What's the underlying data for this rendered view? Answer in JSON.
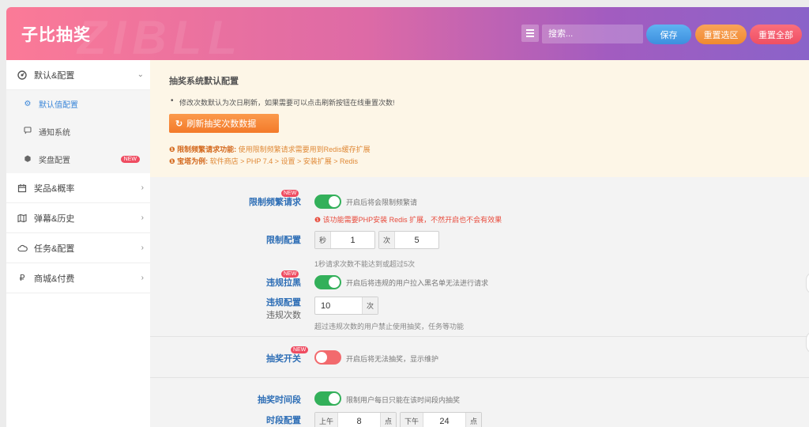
{
  "header": {
    "brand": "子比抽奖",
    "watermark": "ZIBLL",
    "search_placeholder": "搜索...",
    "save_label": "保存",
    "reset_section_label": "重置选区",
    "reset_all_label": "重置全部"
  },
  "sidebar": {
    "items": [
      {
        "icon": "dashboard-icon",
        "label": "默认&配置",
        "expanded": true
      },
      {
        "icon": "cube-icon",
        "label": "奖品&概率"
      },
      {
        "icon": "map-icon",
        "label": "弹幕&历史"
      },
      {
        "icon": "cloud-icon",
        "label": "任务&配置"
      },
      {
        "icon": "ruble-icon",
        "label": "商城&付费"
      }
    ],
    "subitems": [
      {
        "label": "默认值配置",
        "active": true
      },
      {
        "label": "通知系统"
      },
      {
        "label": "奖盘配置",
        "badge": "NEW"
      }
    ]
  },
  "notice": {
    "title": "抽奖系统默认配置",
    "item": "修改次数默认为次日刷新，如果需要可以点击刷新按钮在线重置次数!",
    "refresh_button": "刷新抽奖次数数据",
    "tip1_label": "限制频繁请求功能:",
    "tip1_text": "使用限制频繁请求需要用到Redis缓存扩展",
    "tip2_label": "宝塔为例:",
    "tip2_text": "软件商店 > PHP 7.4 > 设置 > 安装扩展 > Redis"
  },
  "settings": {
    "limit_freq": {
      "label": "限制频繁请求",
      "badge": "NEW",
      "enabled": true,
      "desc": "开启后将会限制频繁请",
      "warning": "该功能需要PHP安装 Redis 扩展，不然开启也不会有效果"
    },
    "limit_config": {
      "label": "限制配置",
      "sec_unit": "秒",
      "sec_value": "1",
      "count_unit": "次",
      "count_value": "5",
      "hint": "1秒请求次数不能达到或超过5次"
    },
    "blacklist": {
      "label": "违规拉黑",
      "badge": "NEW",
      "enabled": true,
      "desc": "开启后将违规的用户拉入黑名单无法进行请求"
    },
    "violation_config": {
      "label": "违规配置",
      "sublabel": "违规次数",
      "value": "10",
      "unit": "次",
      "hint": "超过违规次数的用户禁止使用抽奖，任务等功能"
    },
    "lottery_switch": {
      "label": "抽奖开关",
      "badge": "NEW",
      "enabled": false,
      "desc": "开启后将无法抽奖，显示维护"
    },
    "time_period": {
      "label": "抽奖时间段",
      "enabled": true,
      "desc": "限制用户每日只能在该时间段内抽奖"
    },
    "period_config": {
      "label": "时段配置",
      "am_label": "上午",
      "am_value": "8",
      "am_unit": "点",
      "pm_label": "下午",
      "pm_value": "24",
      "pm_unit": "点"
    }
  },
  "colors": {
    "header_gradient_start": "#fb7a97",
    "header_gradient_end": "#8a63c9",
    "accent_blue": "#3a86d9",
    "toggle_on": "#33b05a",
    "toggle_off": "#f26a6d",
    "warning_red": "#e84a3b"
  }
}
